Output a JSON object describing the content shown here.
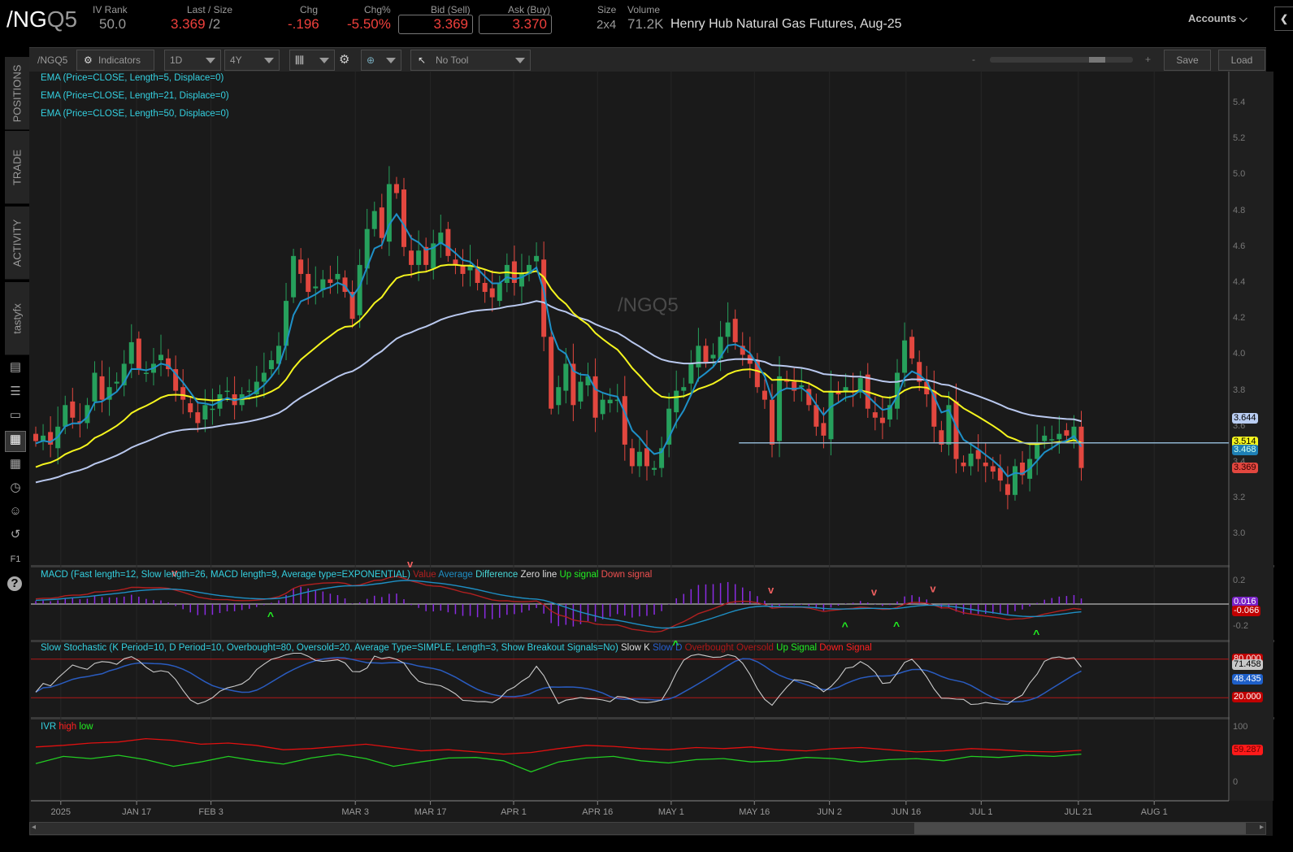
{
  "header": {
    "symbol_root": "/NG",
    "symbol_suffix": "Q5",
    "iv_rank_label": "IV Rank",
    "iv_rank": "50.0",
    "last_label": "Last / Size",
    "last": "3.369",
    "size": "/2",
    "chg_label": "Chg",
    "chg": "-.196",
    "chgpct_label": "Chg%",
    "chgpct": "-5.50%",
    "bid_label": "Bid (Sell)",
    "bid": "3.369",
    "ask_label": "Ask (Buy)",
    "ask": "3.370",
    "size_label": "Size",
    "bidask_size": "2x4",
    "volume_label": "Volume",
    "volume": "71.2K",
    "description": "Henry Hub Natural Gas Futures, Aug-25",
    "accounts": "Accounts"
  },
  "sidebar": {
    "tabs": [
      "POSITIONS",
      "TRADE",
      "ACTIVITY",
      "tastyfx"
    ]
  },
  "toolbar": {
    "symbol": "/NGQ5",
    "indicators": "Indicators",
    "interval": "1D",
    "range": "4Y",
    "tool": "No Tool",
    "zoom_minus": "-",
    "zoom_plus": "+",
    "zoom_level": 0.75,
    "save": "Save",
    "load": "Load"
  },
  "studies": {
    "ema5": "EMA (Price=CLOSE, Length=5, Displace=0)",
    "ema21": "EMA (Price=CLOSE, Length=21, Displace=0)",
    "ema50": "EMA (Price=CLOSE, Length=50, Displace=0)",
    "macd_title": "MACD (Fast length=12, Slow length=26, MACD length=9, Average type=EXPONENTIAL)",
    "macd_legend": [
      "Value",
      "Average",
      "Difference",
      "Zero line",
      "Up signal",
      "Down signal"
    ],
    "stoch_title": "Slow Stochastic (K Period=10, D Period=10, Overbought=80, Oversold=20, Average Type=SIMPLE, Length=3, Show Breakout Signals=No)",
    "stoch_legend": [
      "Slow K",
      "Slow D",
      "Overbought",
      "Oversold",
      "Up Signal",
      "Down Signal"
    ],
    "ivr_title": "IVR",
    "ivr_legend": [
      "high",
      "low"
    ]
  },
  "watermark": "/NGQ5",
  "colors": {
    "up": "#26a05c",
    "down": "#e2473f",
    "ema5": "#1e90c8",
    "ema21": "#f5f51e",
    "ema50": "#b9c8ee",
    "support": "#8fb3cf"
  },
  "chart_data": {
    "type": "candlestick",
    "x_range": [
      -0.5,
      162
    ],
    "y_range": [
      2.86,
      5.5
    ],
    "y_ticks": [
      "5.4",
      "5.2",
      "5.0",
      "4.8",
      "4.6",
      "4.4",
      "4.2",
      "4.0",
      "3.8",
      "3.6",
      "3.4",
      "3.2",
      "3.0"
    ],
    "date_labels": [
      {
        "t": "2025",
        "i": 3.4
      },
      {
        "t": "JAN 17",
        "i": 13.7
      },
      {
        "t": "FEB 3",
        "i": 23.8
      },
      {
        "t": "MAR 3",
        "i": 43.4
      },
      {
        "t": "MAR 17",
        "i": 53.6
      },
      {
        "t": "APR 1",
        "i": 64.9
      },
      {
        "t": "APR 16",
        "i": 76.3
      },
      {
        "t": "MAY 1",
        "i": 86.3
      },
      {
        "t": "MAY 16",
        "i": 97.6
      },
      {
        "t": "JUN 2",
        "i": 107.8
      },
      {
        "t": "JUN 16",
        "i": 118.2
      },
      {
        "t": "JUL 1",
        "i": 128.4
      },
      {
        "t": "JUL 21",
        "i": 141.6
      },
      {
        "t": "AUG 1",
        "i": 151.9
      }
    ],
    "close": [
      3.52,
      3.55,
      3.5,
      3.6,
      3.72,
      3.65,
      3.62,
      3.72,
      3.9,
      3.75,
      3.82,
      3.85,
      3.95,
      4.07,
      3.92,
      3.9,
      3.95,
      4.0,
      3.92,
      3.8,
      3.75,
      3.68,
      3.62,
      3.72,
      3.7,
      3.78,
      3.8,
      3.72,
      3.78,
      3.8,
      3.85,
      3.9,
      3.97,
      4.05,
      4.3,
      4.55,
      4.45,
      4.35,
      4.38,
      4.42,
      4.4,
      4.45,
      4.35,
      4.2,
      4.5,
      4.7,
      4.8,
      4.65,
      4.95,
      4.9,
      4.6,
      4.5,
      4.58,
      4.5,
      4.62,
      4.68,
      4.55,
      4.5,
      4.45,
      4.5,
      4.4,
      4.35,
      4.32,
      4.4,
      4.5,
      4.4,
      4.45,
      4.5,
      4.55,
      4.1,
      3.7,
      3.82,
      3.95,
      3.72,
      3.85,
      3.88,
      3.65,
      3.75,
      3.75,
      3.75,
      3.5,
      3.38,
      3.46,
      3.38,
      3.37,
      3.48,
      3.7,
      3.8,
      3.82,
      3.95,
      4.05,
      3.96,
      4.0,
      4.1,
      4.18,
      4.07,
      4.0,
      3.95,
      3.82,
      3.75,
      3.5,
      3.88,
      3.85,
      3.8,
      3.83,
      3.72,
      3.6,
      3.55,
      3.8,
      3.78,
      3.82,
      3.79,
      3.87,
      3.7,
      3.65,
      3.62,
      3.72,
      3.9,
      4.08,
      3.98,
      3.85,
      3.78,
      3.6,
      3.5,
      3.72,
      3.42,
      3.38,
      3.45,
      3.42,
      3.38,
      3.35,
      3.3,
      3.22,
      3.38,
      3.33,
      3.42,
      3.5,
      3.55,
      3.53,
      3.56,
      3.55,
      3.6,
      3.37
    ],
    "first_open": 3.56,
    "ema_seed": {
      "ema5": 3.5,
      "ema21": 3.36,
      "ema50": 3.28,
      "macd_fast": 3.42,
      "macd_slow": 3.38,
      "macd_avg": 0.03
    },
    "support_level": 3.51,
    "support_from_index": 95.5,
    "price_badges": [
      {
        "v": "3.644",
        "bg": "#b9cdf2",
        "fg": "#000",
        "p": 3.644
      },
      {
        "v": "3.514",
        "bg": "#f5f51e",
        "fg": "#000",
        "p": 3.514
      },
      {
        "v": "3.468",
        "bg": "#1e7fb5",
        "fg": "#cfe",
        "p": 3.468
      },
      {
        "v": "3.369",
        "bg": "#e2473f",
        "fg": "#300",
        "p": 3.369
      }
    ],
    "macd": {
      "y_range": [
        -0.28,
        0.28
      ],
      "ticks": [
        "0.2",
        "-0.2"
      ],
      "badges": [
        {
          "v": "0.016",
          "bg": "#7a22c8",
          "fg": "#fff",
          "p": 0.016
        },
        {
          "v": "-0.066",
          "bg": "#c00000",
          "fg": "#fff",
          "p": -0.066
        }
      ]
    },
    "stoch": {
      "overbought": 80,
      "oversold": 20,
      "badges": [
        {
          "v": "80.000",
          "bg": "#c00000",
          "fg": "#fff",
          "p": 80
        },
        {
          "v": "71.458",
          "bg": "#c8c8c8",
          "fg": "#000",
          "p": 71.458
        },
        {
          "v": "48.435",
          "bg": "#1e5fc8",
          "fg": "#fff",
          "p": 48.435
        },
        {
          "v": "20.000",
          "bg": "#c00000",
          "fg": "#fff",
          "p": 20
        }
      ]
    },
    "ivr": {
      "ticks": [
        "100",
        "0"
      ],
      "high": [
        65,
        68,
        72,
        74,
        80,
        77,
        70,
        72,
        68,
        60,
        62,
        66,
        70,
        64,
        58,
        60,
        56,
        52,
        55,
        62,
        68,
        66,
        62,
        60,
        64,
        62,
        65,
        60,
        58,
        62,
        64,
        60,
        56,
        58,
        62,
        60,
        57,
        56,
        59
      ],
      "low": [
        35,
        48,
        44,
        50,
        42,
        30,
        38,
        48,
        40,
        34,
        45,
        52,
        44,
        30,
        38,
        45,
        46,
        40,
        20,
        38,
        45,
        48,
        40,
        36,
        42,
        44,
        38,
        40,
        46,
        44,
        38,
        42,
        44,
        40,
        48,
        46,
        50,
        48,
        52
      ],
      "badges": [
        {
          "v": "59.287",
          "bg": "#ff1a1a",
          "fg": "#600",
          "p": 59.287
        }
      ]
    }
  }
}
